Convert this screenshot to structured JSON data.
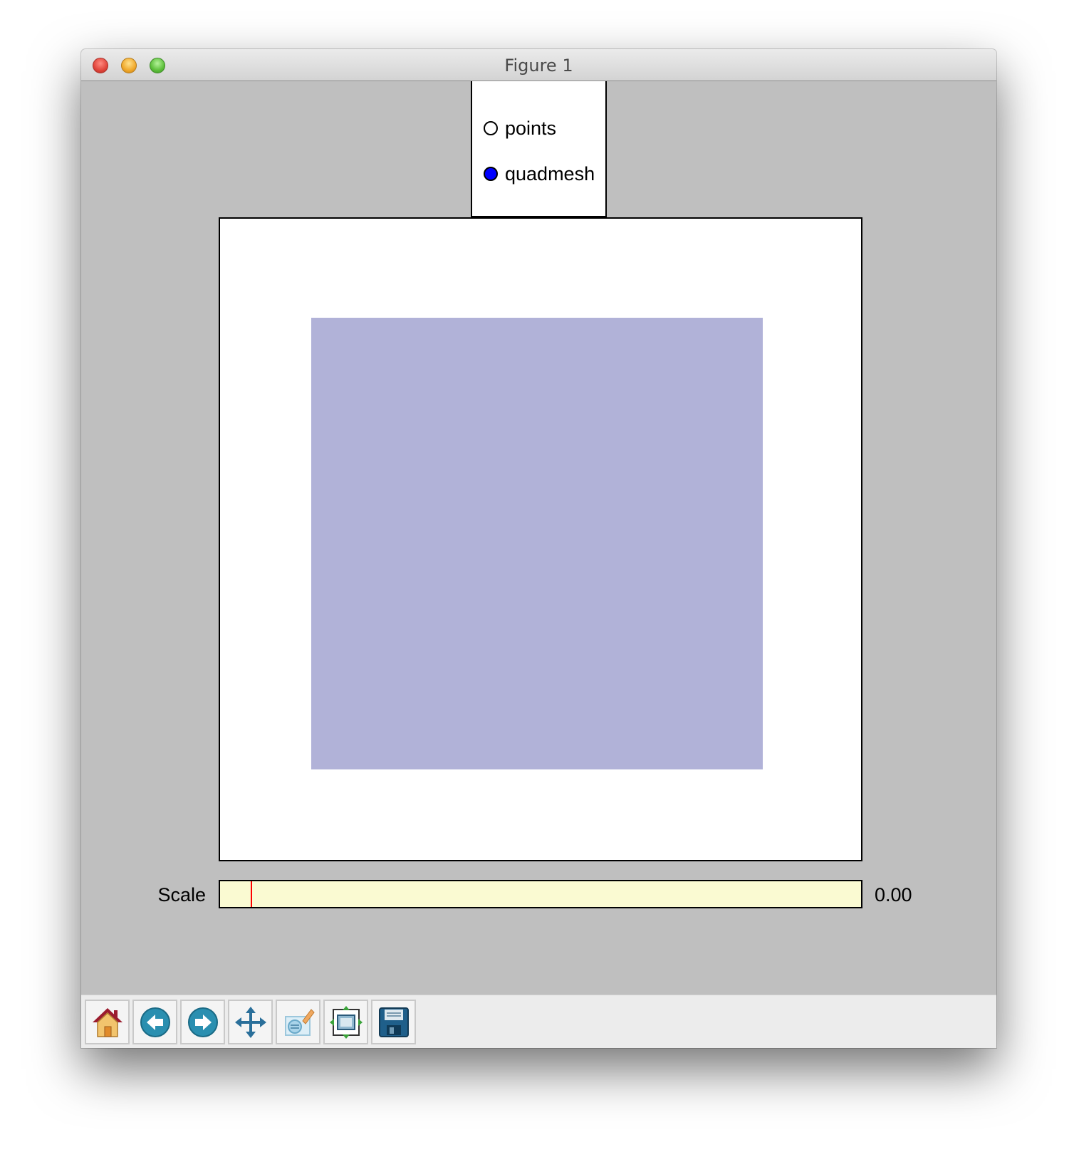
{
  "window": {
    "title": "Figure 1"
  },
  "radio": {
    "options": [
      {
        "label": "points",
        "selected": false
      },
      {
        "label": "quadmesh",
        "selected": true
      }
    ],
    "selected_color": "#0000ff"
  },
  "plot": {
    "mesh_color": "#b1b2d8"
  },
  "slider": {
    "label": "Scale",
    "value_text": "0.00",
    "track_color": "#fafad2",
    "marker_color": "#ff0000",
    "marker_fraction": 0.048
  },
  "toolbar": {
    "buttons": [
      {
        "icon": "home-icon"
      },
      {
        "icon": "back-arrow-icon"
      },
      {
        "icon": "forward-arrow-icon"
      },
      {
        "icon": "pan-icon"
      },
      {
        "icon": "zoom-icon"
      },
      {
        "icon": "configure-subplots-icon"
      },
      {
        "icon": "save-icon"
      }
    ]
  }
}
